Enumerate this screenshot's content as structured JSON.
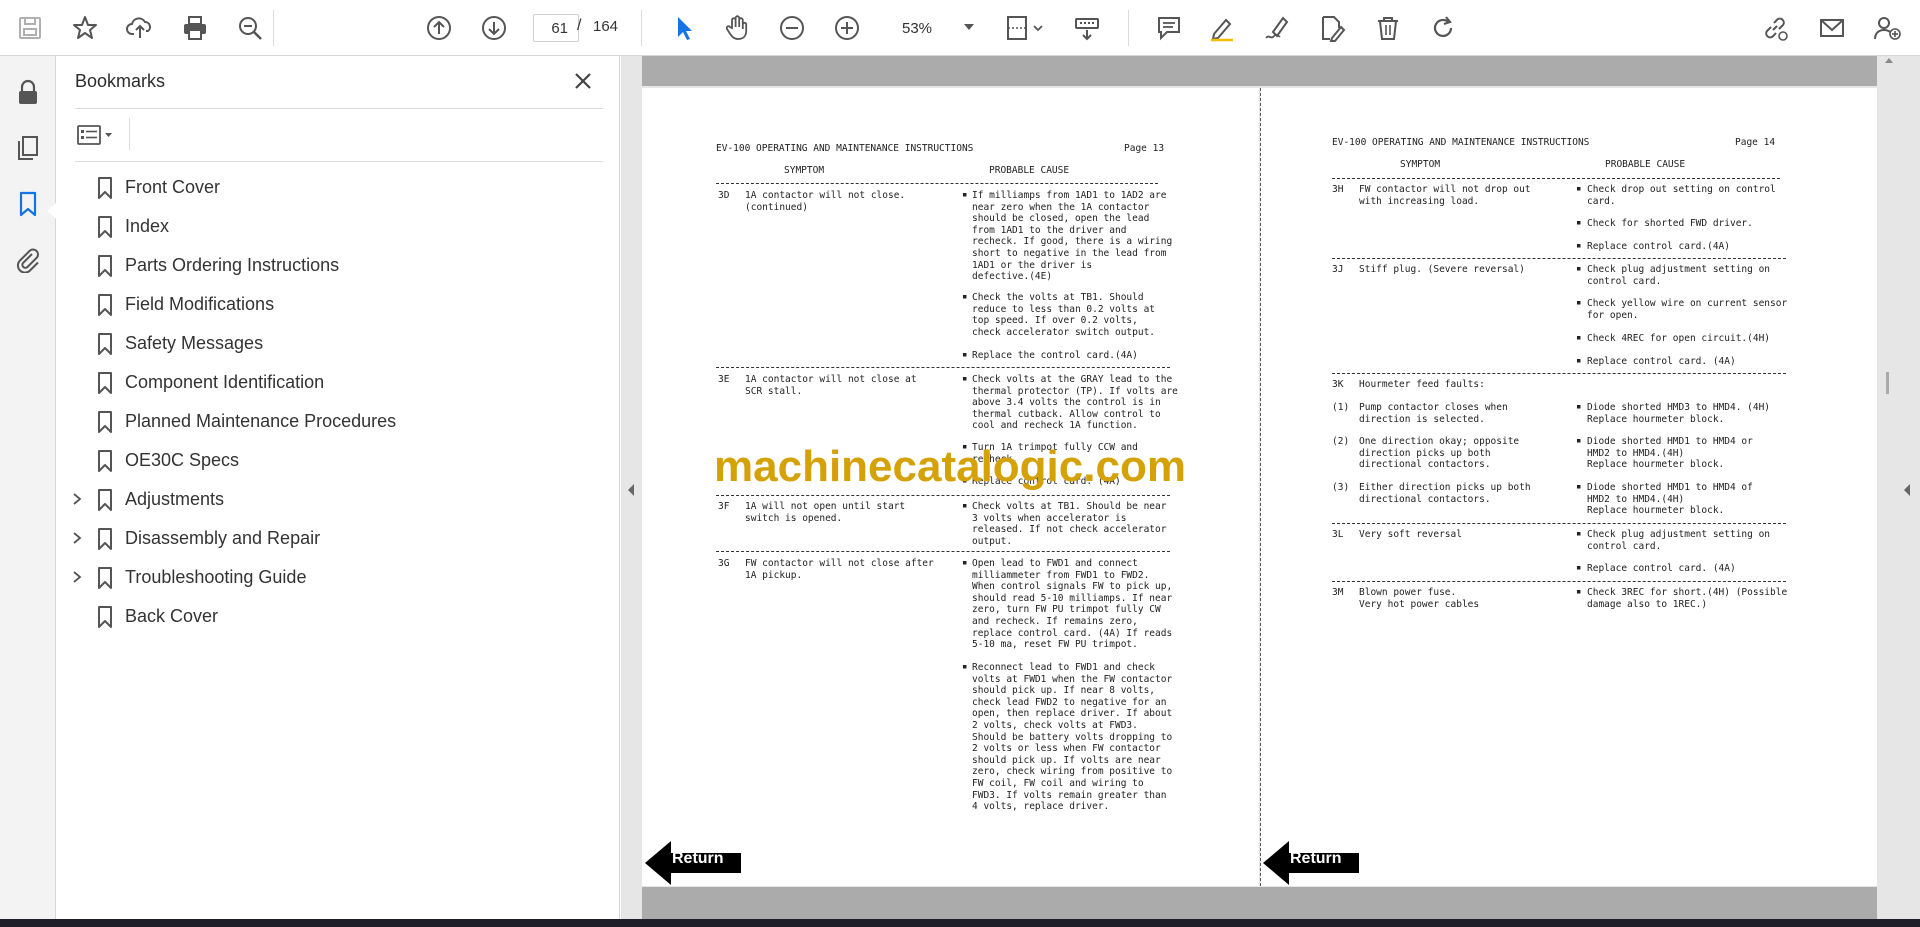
{
  "toolbar": {
    "page_current": "61",
    "page_separator": "/",
    "page_total": "164",
    "zoom": "53%",
    "accent_color": "#1473e6"
  },
  "bookmarks": {
    "title": "Bookmarks",
    "items": [
      {
        "label": "Front Cover",
        "expandable": false
      },
      {
        "label": "Index",
        "expandable": false
      },
      {
        "label": "Parts Ordering Instructions",
        "expandable": false
      },
      {
        "label": "Field Modifications",
        "expandable": false
      },
      {
        "label": "Safety Messages",
        "expandable": false
      },
      {
        "label": "Component Identification",
        "expandable": false
      },
      {
        "label": "Planned Maintenance Procedures",
        "expandable": false
      },
      {
        "label": "OE30C Specs",
        "expandable": false
      },
      {
        "label": "Adjustments",
        "expandable": true
      },
      {
        "label": "Disassembly and Repair",
        "expandable": true
      },
      {
        "label": "Troubleshooting Guide",
        "expandable": true
      },
      {
        "label": "Back Cover",
        "expandable": false
      }
    ]
  },
  "document": {
    "watermark": "machinecatalogic.com",
    "left_page": {
      "header": "EV-100 OPERATING AND MAINTENANCE INSTRUCTIONS",
      "page_label": "Page 13",
      "symptom_heading": "SYMPTOM",
      "cause_heading": "PROBABLE CAUSE",
      "rows": [
        {
          "code": "3D",
          "symptom": "1A contactor will not close.\n(continued)",
          "causes": [
            "If milliamps from 1AD1 to 1AD2 are\nnear zero when the 1A contactor\nshould be closed, open the lead\nfrom 1AD1 to the driver and\nrecheck. If good, there is a wiring\nshort to negative in the lead from\n1AD1 or the driver is\ndefective.(4E)",
            "Check the volts at TB1. Should\nreduce to less than 0.2 volts at\ntop speed.  If over 0.2 volts,\ncheck accelerator switch output.",
            "Replace the control card.(4A)"
          ]
        },
        {
          "code": "3E",
          "symptom": "1A contactor will not close at\nSCR stall.",
          "causes": [
            "Check volts at the GRAY lead to the\nthermal protector (TP). If volts are\nabove 3.4 volts the control is in\nthermal cutback. Allow control to\ncool and recheck 1A function.",
            "Turn 1A trimpot fully CCW and\nrecheck.",
            "Replace control card. (4A)"
          ]
        },
        {
          "code": "3F",
          "symptom": "1A will not open until start\nswitch is opened.",
          "causes": [
            "Check volts at TB1. Should be near\n3 volts when accelerator is\nreleased. If not check accelerator\noutput."
          ]
        },
        {
          "code": "3G",
          "symptom": "FW contactor will not close after\n1A pickup.",
          "causes": [
            "Open lead to FWD1 and connect\nmilliammeter from FWD1 to FWD2.\nWhen control signals FW to pick up,\nshould read 5-10 milliamps. If near\nzero, turn FW PU trimpot fully CW\nand recheck. If remains zero,\nreplace control card. (4A) If reads\n5-10 ma, reset FW PU trimpot.",
            "Reconnect lead to FWD1 and check\nvolts at FWD1 when the FW contactor\nshould pick up. If near 8 volts,\ncheck lead FWD2 to negative for an\nopen, then replace driver. If about\n2 volts, check volts at FWD3.\nShould be battery volts dropping to\n2 volts or less when FW contactor\nshould pick up. If volts are near\nzero, check wiring from positive to\nFW coil, FW coil and wiring to\nFWD3. If volts remain greater than\n4 volts, replace driver."
          ]
        }
      ],
      "return_label": "Return"
    },
    "right_page": {
      "header": "EV-100 OPERATING AND MAINTENANCE INSTRUCTIONS",
      "page_label": "Page 14",
      "symptom_heading": "SYMPTOM",
      "cause_heading": "PROBABLE CAUSE",
      "rows": [
        {
          "code": "3H",
          "symptom": "FW contactor will not drop out\nwith increasing load.",
          "causes": [
            "Check drop out setting on control\ncard.",
            "Check for shorted FWD driver.",
            "Replace control card.(4A)"
          ]
        },
        {
          "code": "3J",
          "symptom": "Stiff plug. (Severe reversal)",
          "causes": [
            "Check plug adjustment setting on\ncontrol card.",
            "Check yellow wire on current sensor\nfor open.",
            "Check 4REC for open circuit.(4H)",
            "Replace control card. (4A)"
          ]
        },
        {
          "code": "3K",
          "symptom": "Hourmeter feed faults:",
          "causes": []
        },
        {
          "code": "(1)",
          "symptom": "Pump contactor closes when\ndirection is selected.",
          "causes": [
            "Diode shorted HMD3 to HMD4. (4H)\nReplace hourmeter block."
          ]
        },
        {
          "code": "(2)",
          "symptom": "One direction okay; opposite\ndirection picks up both\ndirectional contactors.",
          "causes": [
            "Diode shorted HMD1 to HMD4 or\nHMD2 to HMD4.(4H)\nReplace hourmeter block."
          ]
        },
        {
          "code": "(3)",
          "symptom": "Either direction picks up both\ndirectional contactors.",
          "causes": [
            "Diode shorted HMD1 to HMD4 of\nHMD2 to HMD4.(4H)\nReplace hourmeter block."
          ]
        },
        {
          "code": "3L",
          "symptom": "Very soft reversal",
          "causes": [
            "Check plug adjustment setting on\ncontrol card.",
            "Replace control card. (4A)"
          ]
        },
        {
          "code": "3M",
          "symptom": "Blown power fuse.\nVery hot power cables",
          "causes": [
            "Check 3REC for short.(4H) (Possible\ndamage also to 1REC.)"
          ]
        }
      ],
      "return_label": "Return"
    }
  }
}
